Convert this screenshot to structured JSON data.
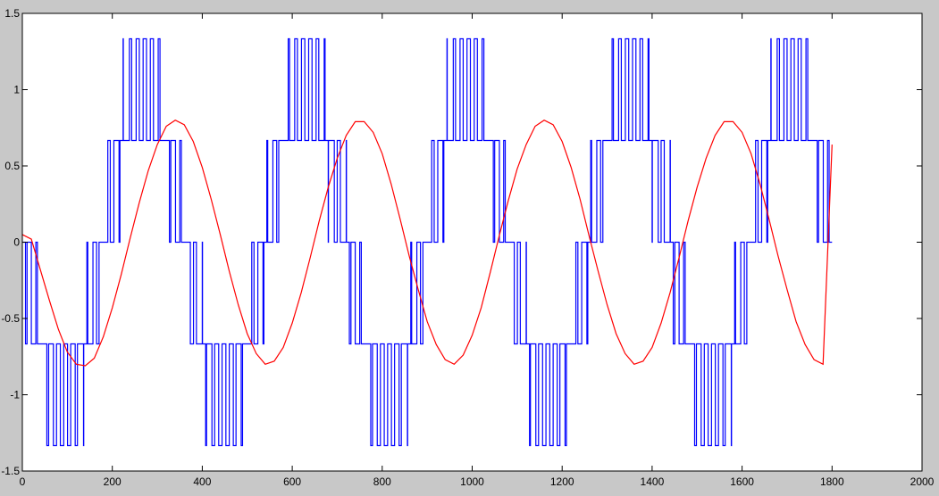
{
  "chart_data": {
    "type": "line",
    "title": "",
    "xlabel": "",
    "ylabel": "",
    "xlim": [
      0,
      2000
    ],
    "ylim": [
      -1.5,
      1.5
    ],
    "grid": false,
    "x_ticks": [
      "0",
      "200",
      "400",
      "600",
      "800",
      "1000",
      "1200",
      "1400",
      "1600",
      "1800",
      "2000"
    ],
    "y_ticks": [
      "1.5",
      "1",
      "0.5",
      "0",
      "-0.5",
      "-1",
      "-1.5"
    ],
    "series": [
      {
        "color": "#0000ff",
        "style": "stepped multilevel PWM",
        "levels": [
          -1.3333,
          -0.6667,
          0,
          0.6667,
          1.3333
        ],
        "x_range": [
          0,
          1800
        ],
        "period": 360,
        "carrier_period": 16,
        "modulation_amplitude": 0.8
      },
      {
        "color": "#ff0000",
        "style": "line",
        "x": [
          0,
          20,
          40,
          60,
          80,
          100,
          120,
          140,
          160,
          180,
          200,
          220,
          240,
          260,
          280,
          300,
          320,
          340,
          360,
          380,
          400,
          420,
          440,
          460,
          480,
          500,
          520,
          540,
          560,
          580,
          600,
          620,
          640,
          660,
          680,
          700,
          720,
          740,
          760,
          780,
          800,
          820,
          840,
          860,
          880,
          900,
          920,
          940,
          960,
          980,
          1000,
          1020,
          1040,
          1060,
          1080,
          1100,
          1120,
          1140,
          1160,
          1180,
          1200,
          1220,
          1240,
          1260,
          1280,
          1300,
          1320,
          1340,
          1360,
          1380,
          1400,
          1420,
          1440,
          1460,
          1480,
          1500,
          1520,
          1540,
          1560,
          1580,
          1600,
          1620,
          1640,
          1660,
          1680,
          1700,
          1720,
          1740,
          1760,
          1780,
          1800
        ],
        "y": [
          0.05,
          0.02,
          -0.18,
          -0.38,
          -0.57,
          -0.72,
          -0.8,
          -0.81,
          -0.76,
          -0.62,
          -0.43,
          -0.21,
          0.03,
          0.26,
          0.47,
          0.64,
          0.76,
          0.8,
          0.77,
          0.66,
          0.49,
          0.28,
          0.05,
          -0.19,
          -0.41,
          -0.6,
          -0.73,
          -0.8,
          -0.78,
          -0.69,
          -0.53,
          -0.33,
          -0.1,
          0.14,
          0.36,
          0.55,
          0.7,
          0.79,
          0.79,
          0.72,
          0.58,
          0.38,
          0.15,
          -0.09,
          -0.31,
          -0.52,
          -0.67,
          -0.77,
          -0.8,
          -0.74,
          -0.61,
          -0.43,
          -0.2,
          0.04,
          0.27,
          0.48,
          0.64,
          0.76,
          0.8,
          0.77,
          0.66,
          0.49,
          0.28,
          0.04,
          -0.19,
          -0.41,
          -0.6,
          -0.73,
          -0.8,
          -0.78,
          -0.69,
          -0.53,
          -0.33,
          -0.1,
          0.14,
          0.36,
          0.55,
          0.7,
          0.79,
          0.79,
          0.72,
          0.58,
          0.38,
          0.15,
          -0.09,
          -0.31,
          -0.52,
          -0.67,
          -0.77,
          -0.8,
          0.64
        ]
      }
    ]
  }
}
